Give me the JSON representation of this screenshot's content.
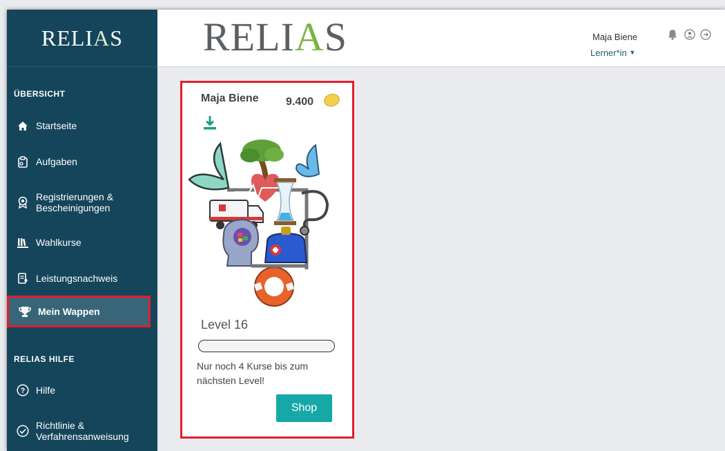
{
  "sidebar": {
    "logo": "RELI",
    "logo_a": "A",
    "logo_end": "S",
    "section_overview": "ÜBERSICHT",
    "section_help": "RELIAS HILFE",
    "items": [
      {
        "label": "Startseite",
        "icon": "home-icon"
      },
      {
        "label": "Aufgaben",
        "icon": "clipboard-icon"
      },
      {
        "label": "Registrierungen &",
        "label2": "Bescheinigungen",
        "icon": "badge-icon"
      },
      {
        "label": "Wahlkurse",
        "icon": "books-icon"
      },
      {
        "label": "Leistungsnachweis",
        "icon": "certificate-icon"
      },
      {
        "label": "Mein Wappen",
        "icon": "trophy-icon"
      }
    ],
    "help_items": [
      {
        "label": "Hilfe",
        "icon": "question-circle-icon"
      },
      {
        "label": "Richtlinie &",
        "label2": "Verfahrensanweisung",
        "icon": "check-circle-icon"
      }
    ]
  },
  "header": {
    "logo": "RELI",
    "logo_a": "A",
    "logo_end": "S",
    "user_name": "Maja Biene",
    "user_role": "Lerner*in"
  },
  "card": {
    "name": "Maja Biene",
    "coins": "9.400",
    "level": "Level 16",
    "progress": 0,
    "note": "Nur noch 4 Kurse bis zum nächsten Level!",
    "shop_label": "Shop"
  },
  "colors": {
    "sidebar_bg": "#15455b",
    "accent": "#16a8a6",
    "highlight_border": "#e31d2b"
  }
}
